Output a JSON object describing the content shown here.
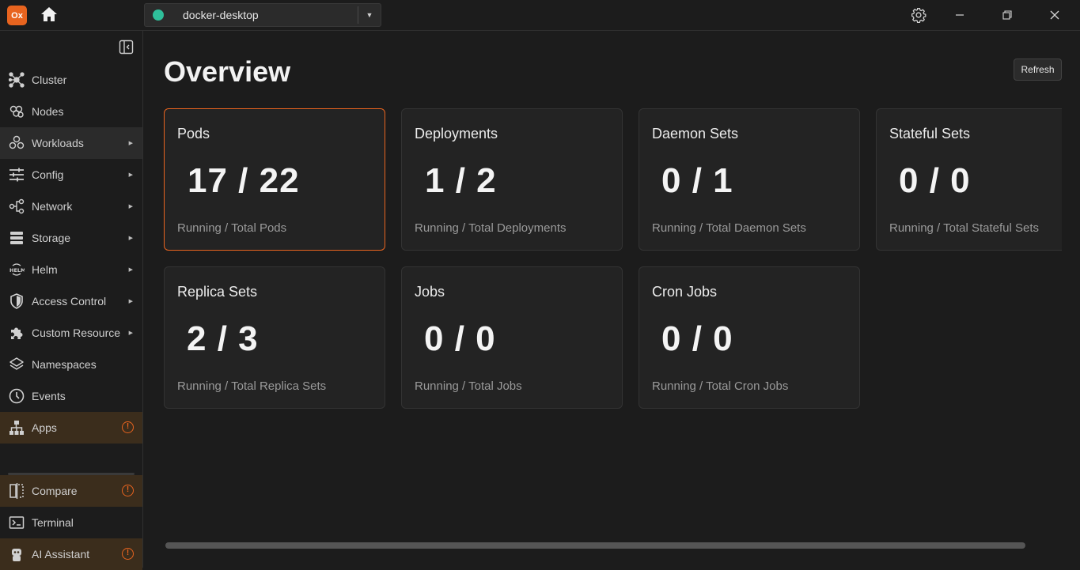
{
  "titlebar": {
    "logo_text": "Ox",
    "context": "docker-desktop",
    "context_color": "#2fbf9a"
  },
  "sidebar": {
    "items": [
      {
        "label": "Cluster",
        "icon": "cluster-icon"
      },
      {
        "label": "Nodes",
        "icon": "nodes-icon"
      },
      {
        "label": "Workloads",
        "icon": "workloads-icon",
        "expandable": true,
        "active": true
      },
      {
        "label": "Config",
        "icon": "sliders-icon",
        "expandable": true
      },
      {
        "label": "Network",
        "icon": "network-icon",
        "expandable": true
      },
      {
        "label": "Storage",
        "icon": "storage-icon",
        "expandable": true
      },
      {
        "label": "Helm",
        "icon": "helm-icon",
        "expandable": true
      },
      {
        "label": "Access Control",
        "icon": "shield-icon",
        "expandable": true
      },
      {
        "label": "Custom Resource",
        "icon": "puzzle-icon",
        "expandable": true
      },
      {
        "label": "Namespaces",
        "icon": "layers-icon"
      },
      {
        "label": "Events",
        "icon": "clock-icon"
      },
      {
        "label": "Apps",
        "icon": "hierarchy-icon",
        "alert": true
      }
    ],
    "bottom_items": [
      {
        "label": "Compare",
        "icon": "compare-icon",
        "alert": true
      },
      {
        "label": "Terminal",
        "icon": "terminal-icon"
      },
      {
        "label": "AI Assistant",
        "icon": "robot-icon",
        "alert": true
      }
    ]
  },
  "main": {
    "title": "Overview",
    "refresh_label": "Refresh",
    "cards": [
      {
        "title": "Pods",
        "value": "17 / 22",
        "subtitle": "Running / Total Pods"
      },
      {
        "title": "Deployments",
        "value": "1 / 2",
        "subtitle": "Running / Total Deployments"
      },
      {
        "title": "Daemon Sets",
        "value": "0 / 1",
        "subtitle": "Running / Total Daemon Sets"
      },
      {
        "title": "Stateful Sets",
        "value": "0 / 0",
        "subtitle": "Running / Total Stateful Sets"
      },
      {
        "title": "Replica Sets",
        "value": "2 / 3",
        "subtitle": "Running / Total Replica Sets"
      },
      {
        "title": "Jobs",
        "value": "0 / 0",
        "subtitle": "Running / Total Jobs"
      },
      {
        "title": "Cron Jobs",
        "value": "0 / 0",
        "subtitle": "Running / Total Cron Jobs"
      }
    ]
  },
  "colors": {
    "accent": "#e8641f",
    "background": "#1c1c1c",
    "card": "#232323"
  }
}
